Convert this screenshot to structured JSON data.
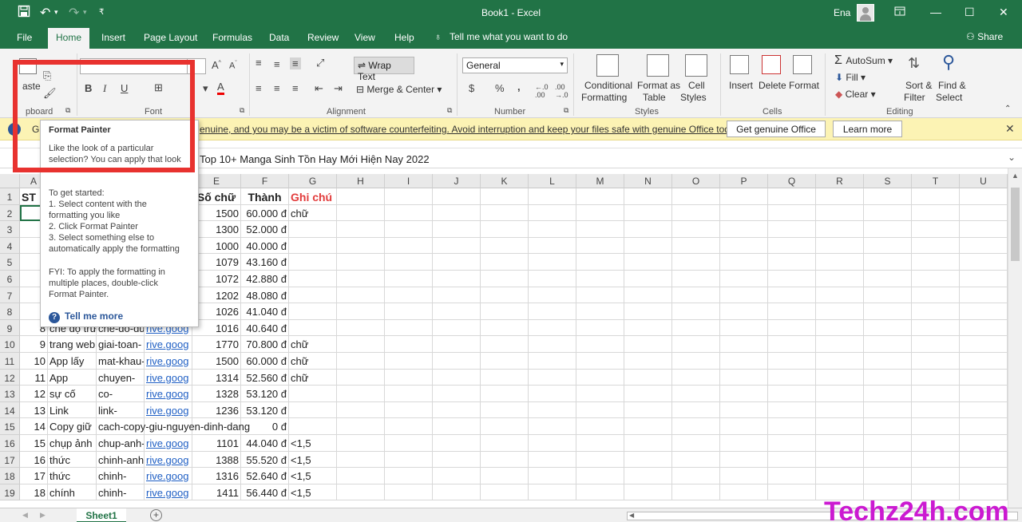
{
  "window": {
    "title": "Book1  -  Excel",
    "user": "Ena"
  },
  "menu": {
    "tabs": [
      "File",
      "Home",
      "Insert",
      "Page Layout",
      "Formulas",
      "Data",
      "Review",
      "View",
      "Help"
    ],
    "tell_me": "Tell me what you want to do",
    "share": "Share"
  },
  "ribbon": {
    "clipboard": {
      "paste": "aste",
      "group": "pboard"
    },
    "font": {
      "group": "Font"
    },
    "alignment": {
      "wrap_text": "Wrap Text",
      "merge_center": "Merge & Center",
      "group": "Alignment"
    },
    "number": {
      "format": "General",
      "currency": "$",
      "percent": "%",
      "comma": ",",
      "group": "Number"
    },
    "styles": {
      "conditional": "Conditional",
      "conditional2": "Formatting",
      "format_as": "Format as",
      "format_as2": "Table",
      "cell": "Cell",
      "cell2": "Styles",
      "group": "Styles"
    },
    "cells": {
      "insert": "Insert",
      "delete": "Delete",
      "format": "Format",
      "group": "Cells"
    },
    "editing": {
      "autosum": "AutoSum",
      "fill": "Fill",
      "clear": "Clear",
      "sort": "Sort &",
      "sort2": "Filter",
      "find": "Find &",
      "find2": "Select",
      "group": "Editing"
    }
  },
  "banner": {
    "prefix": "G",
    "message": "enuine, and you may be a victim of software counterfeiting. Avoid interruption and keep your files safe with genuine Office today.",
    "get_button": "Get genuine Office",
    "learn_button": "Learn more"
  },
  "formula_bar": {
    "text": "Top 10+ Manga Sinh Tồn Hay Mới Hiện Nay 2022"
  },
  "tooltip": {
    "title": "Format Painter",
    "desc": [
      "Like the look of a particular",
      "selection? You can apply that look"
    ],
    "steps": [
      "To get started:",
      "1. Select content with the",
      "formatting you like",
      "2. Click Format Painter",
      "3. Select something else to",
      "automatically apply the formatting"
    ],
    "fyi": [
      "FYI: To apply the formatting in",
      "multiple places, double-click",
      "Format Painter."
    ],
    "tell_more": "Tell me more"
  },
  "sheet": {
    "columns": [
      "A",
      "B",
      "C",
      "D",
      "E",
      "F",
      "G",
      "H",
      "I",
      "J",
      "K",
      "L",
      "M",
      "N",
      "O",
      "P",
      "Q",
      "R",
      "S",
      "T",
      "U"
    ],
    "rows": [
      "1",
      "2",
      "3",
      "4",
      "5",
      "6",
      "7",
      "8",
      "9",
      "10",
      "11",
      "12",
      "13",
      "14",
      "15",
      "16",
      "17",
      "18",
      "19"
    ],
    "header_row": {
      "a": "ST",
      "e": "Số chữ",
      "f": "Thành",
      "g": "Ghi chú"
    },
    "data": [
      {
        "a": "",
        "b": "",
        "c": "",
        "d": "",
        "e": "1500",
        "f": "60.000 đ",
        "g": "chữ"
      },
      {
        "a": "",
        "b": "",
        "c": "",
        "d": "",
        "e": "1300",
        "f": "52.000 đ",
        "g": ""
      },
      {
        "a": "",
        "b": "",
        "c": "",
        "d": "",
        "e": "1000",
        "f": "40.000 đ",
        "g": ""
      },
      {
        "a": "",
        "b": "",
        "c": "",
        "d": "",
        "e": "1079",
        "f": "43.160 đ",
        "g": ""
      },
      {
        "a": "",
        "b": "",
        "c": "",
        "d": "",
        "e": "1072",
        "f": "42.880 đ",
        "g": ""
      },
      {
        "a": "",
        "b": "",
        "c": "",
        "d": "",
        "e": "1202",
        "f": "48.080 đ",
        "g": ""
      },
      {
        "a": "",
        "b": "",
        "c": "",
        "d": "",
        "e": "1026",
        "f": "41.040 đ",
        "g": ""
      },
      {
        "a": "8",
        "b": "chế độ trữ",
        "c": "che-do-du-",
        "d": "rive.goog",
        "e": "1016",
        "f": "40.640 đ",
        "g": ""
      },
      {
        "a": "9",
        "b": "trang web",
        "c": "giai-toan-",
        "d": "rive.goog",
        "e": "1770",
        "f": "70.800 đ",
        "g": "chữ"
      },
      {
        "a": "10",
        "b": "App lấy",
        "c": "mat-khau-",
        "d": "rive.goog",
        "e": "1500",
        "f": "60.000 đ",
        "g": "chữ"
      },
      {
        "a": "11",
        "b": "App",
        "c": "chuyen-",
        "d": "rive.goog",
        "e": "1314",
        "f": "52.560 đ",
        "g": "chữ"
      },
      {
        "a": "12",
        "b": "sự cố",
        "c": "co-",
        "d": "rive.goog",
        "e": "1328",
        "f": "53.120 đ",
        "g": ""
      },
      {
        "a": "13",
        "b": "Link",
        "c": "link-",
        "d": "rive.goog",
        "e": "1236",
        "f": "53.120 đ",
        "g": ""
      },
      {
        "a": "14",
        "b": "Copy giữ",
        "c": "cach-copy-giu-nguyen-dinh-dang",
        "d": "",
        "e": "",
        "f": "0 đ",
        "g": ""
      },
      {
        "a": "15",
        "b": "chụp ảnh",
        "c": "chup-anh-",
        "d": "rive.goog",
        "e": "1101",
        "f": "44.040 đ",
        "g": "<1,5"
      },
      {
        "a": "16",
        "b": "thức",
        "c": "chinh-anh-",
        "d": "rive.goog",
        "e": "1388",
        "f": "55.520 đ",
        "g": "<1,5"
      },
      {
        "a": "17",
        "b": "thức",
        "c": "chinh-",
        "d": "rive.goog",
        "e": "1316",
        "f": "52.640 đ",
        "g": "<1,5"
      },
      {
        "a": "18",
        "b": "chính",
        "c": "chinh-",
        "d": "rive.goog",
        "e": "1411",
        "f": "56.440 đ",
        "g": "<1,5"
      }
    ]
  },
  "sheet_tabs": {
    "active": "Sheet1",
    "add": "+"
  },
  "watermark": "Techz24h.com",
  "colors": {
    "excel_green": "#217346",
    "banner_yellow": "#fcf3b4",
    "highlight_red": "#e8322f",
    "watermark": "#cb1ad1"
  }
}
